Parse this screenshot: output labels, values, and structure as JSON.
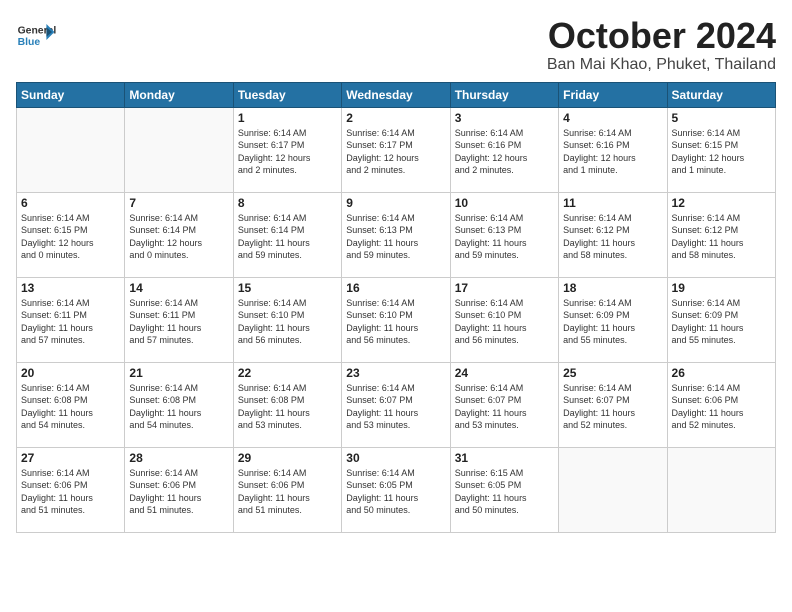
{
  "header": {
    "logo_general": "General",
    "logo_blue": "Blue",
    "month_title": "October 2024",
    "location": "Ban Mai Khao, Phuket, Thailand"
  },
  "weekdays": [
    "Sunday",
    "Monday",
    "Tuesday",
    "Wednesday",
    "Thursday",
    "Friday",
    "Saturday"
  ],
  "weeks": [
    [
      {
        "day": "",
        "detail": ""
      },
      {
        "day": "",
        "detail": ""
      },
      {
        "day": "1",
        "detail": "Sunrise: 6:14 AM\nSunset: 6:17 PM\nDaylight: 12 hours\nand 2 minutes."
      },
      {
        "day": "2",
        "detail": "Sunrise: 6:14 AM\nSunset: 6:17 PM\nDaylight: 12 hours\nand 2 minutes."
      },
      {
        "day": "3",
        "detail": "Sunrise: 6:14 AM\nSunset: 6:16 PM\nDaylight: 12 hours\nand 2 minutes."
      },
      {
        "day": "4",
        "detail": "Sunrise: 6:14 AM\nSunset: 6:16 PM\nDaylight: 12 hours\nand 1 minute."
      },
      {
        "day": "5",
        "detail": "Sunrise: 6:14 AM\nSunset: 6:15 PM\nDaylight: 12 hours\nand 1 minute."
      }
    ],
    [
      {
        "day": "6",
        "detail": "Sunrise: 6:14 AM\nSunset: 6:15 PM\nDaylight: 12 hours\nand 0 minutes."
      },
      {
        "day": "7",
        "detail": "Sunrise: 6:14 AM\nSunset: 6:14 PM\nDaylight: 12 hours\nand 0 minutes."
      },
      {
        "day": "8",
        "detail": "Sunrise: 6:14 AM\nSunset: 6:14 PM\nDaylight: 11 hours\nand 59 minutes."
      },
      {
        "day": "9",
        "detail": "Sunrise: 6:14 AM\nSunset: 6:13 PM\nDaylight: 11 hours\nand 59 minutes."
      },
      {
        "day": "10",
        "detail": "Sunrise: 6:14 AM\nSunset: 6:13 PM\nDaylight: 11 hours\nand 59 minutes."
      },
      {
        "day": "11",
        "detail": "Sunrise: 6:14 AM\nSunset: 6:12 PM\nDaylight: 11 hours\nand 58 minutes."
      },
      {
        "day": "12",
        "detail": "Sunrise: 6:14 AM\nSunset: 6:12 PM\nDaylight: 11 hours\nand 58 minutes."
      }
    ],
    [
      {
        "day": "13",
        "detail": "Sunrise: 6:14 AM\nSunset: 6:11 PM\nDaylight: 11 hours\nand 57 minutes."
      },
      {
        "day": "14",
        "detail": "Sunrise: 6:14 AM\nSunset: 6:11 PM\nDaylight: 11 hours\nand 57 minutes."
      },
      {
        "day": "15",
        "detail": "Sunrise: 6:14 AM\nSunset: 6:10 PM\nDaylight: 11 hours\nand 56 minutes."
      },
      {
        "day": "16",
        "detail": "Sunrise: 6:14 AM\nSunset: 6:10 PM\nDaylight: 11 hours\nand 56 minutes."
      },
      {
        "day": "17",
        "detail": "Sunrise: 6:14 AM\nSunset: 6:10 PM\nDaylight: 11 hours\nand 56 minutes."
      },
      {
        "day": "18",
        "detail": "Sunrise: 6:14 AM\nSunset: 6:09 PM\nDaylight: 11 hours\nand 55 minutes."
      },
      {
        "day": "19",
        "detail": "Sunrise: 6:14 AM\nSunset: 6:09 PM\nDaylight: 11 hours\nand 55 minutes."
      }
    ],
    [
      {
        "day": "20",
        "detail": "Sunrise: 6:14 AM\nSunset: 6:08 PM\nDaylight: 11 hours\nand 54 minutes."
      },
      {
        "day": "21",
        "detail": "Sunrise: 6:14 AM\nSunset: 6:08 PM\nDaylight: 11 hours\nand 54 minutes."
      },
      {
        "day": "22",
        "detail": "Sunrise: 6:14 AM\nSunset: 6:08 PM\nDaylight: 11 hours\nand 53 minutes."
      },
      {
        "day": "23",
        "detail": "Sunrise: 6:14 AM\nSunset: 6:07 PM\nDaylight: 11 hours\nand 53 minutes."
      },
      {
        "day": "24",
        "detail": "Sunrise: 6:14 AM\nSunset: 6:07 PM\nDaylight: 11 hours\nand 53 minutes."
      },
      {
        "day": "25",
        "detail": "Sunrise: 6:14 AM\nSunset: 6:07 PM\nDaylight: 11 hours\nand 52 minutes."
      },
      {
        "day": "26",
        "detail": "Sunrise: 6:14 AM\nSunset: 6:06 PM\nDaylight: 11 hours\nand 52 minutes."
      }
    ],
    [
      {
        "day": "27",
        "detail": "Sunrise: 6:14 AM\nSunset: 6:06 PM\nDaylight: 11 hours\nand 51 minutes."
      },
      {
        "day": "28",
        "detail": "Sunrise: 6:14 AM\nSunset: 6:06 PM\nDaylight: 11 hours\nand 51 minutes."
      },
      {
        "day": "29",
        "detail": "Sunrise: 6:14 AM\nSunset: 6:06 PM\nDaylight: 11 hours\nand 51 minutes."
      },
      {
        "day": "30",
        "detail": "Sunrise: 6:14 AM\nSunset: 6:05 PM\nDaylight: 11 hours\nand 50 minutes."
      },
      {
        "day": "31",
        "detail": "Sunrise: 6:15 AM\nSunset: 6:05 PM\nDaylight: 11 hours\nand 50 minutes."
      },
      {
        "day": "",
        "detail": ""
      },
      {
        "day": "",
        "detail": ""
      }
    ]
  ]
}
